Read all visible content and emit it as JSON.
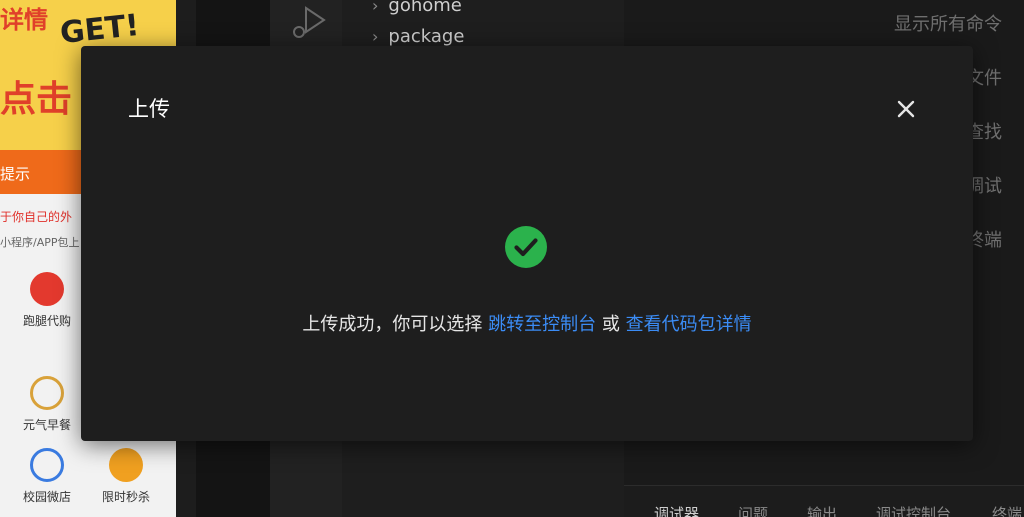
{
  "simulator": {
    "banner_text_1": "详情",
    "banner_text_2": "GET!",
    "banner_text_3": "点击",
    "promo_text": "提示",
    "tagline": "于你自己的外",
    "subline": "小程序/APP包上",
    "items": [
      {
        "label": "跑腿代购",
        "icon": "runner-icon",
        "color": "#e3392e"
      },
      {
        "label": "元气早餐",
        "icon": "breakfast-icon",
        "color": "#d9a23a"
      },
      {
        "label": "校园微店",
        "icon": "shop-icon",
        "color": "#3a7be0"
      },
      {
        "label": "限时秒杀",
        "icon": "timer-icon",
        "color": "#f0a020"
      }
    ]
  },
  "explorer": {
    "items": [
      {
        "label": "gohome"
      },
      {
        "label": "package"
      }
    ]
  },
  "welcome": {
    "commands": [
      "显示所有命令",
      "文件",
      "查找",
      "调试",
      "终端"
    ]
  },
  "panel": {
    "tabs": [
      "调试器",
      "问题",
      "输出",
      "调试控制台",
      "终端"
    ]
  },
  "modal": {
    "title": "上传",
    "message_prefix": "上传成功，你可以选择",
    "link_console": "跳转至控制台",
    "message_or": "或",
    "link_details": "查看代码包详情",
    "success_color": "#2bb24c",
    "link_color": "#3b8cf5"
  }
}
